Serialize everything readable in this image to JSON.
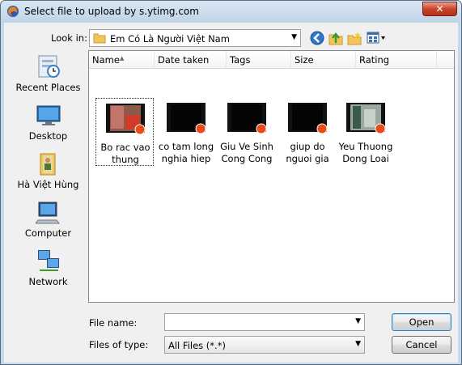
{
  "window": {
    "title": "Select file to upload by s.ytimg.com",
    "close_label": "✕"
  },
  "toolbar": {
    "lookin_label": "Look in:",
    "lookin_value": "Em Có Là Người Việt Nam",
    "icons": [
      "back-icon",
      "up-folder-icon",
      "new-folder-icon",
      "views-icon"
    ]
  },
  "places": [
    {
      "label": "Recent Places",
      "icon": "recent-places-icon"
    },
    {
      "label": "Desktop",
      "icon": "desktop-icon"
    },
    {
      "label": "Hà Việt Hùng",
      "icon": "user-folder-icon"
    },
    {
      "label": "Computer",
      "icon": "computer-icon"
    },
    {
      "label": "Network",
      "icon": "network-icon"
    }
  ],
  "columns": [
    "Name",
    "Date taken",
    "Tags",
    "Size",
    "Rating"
  ],
  "files": [
    {
      "line1": "Bo rac vao",
      "line2": "thung",
      "selected": true
    },
    {
      "line1": "co tam long",
      "line2": "nghia hiep",
      "selected": false
    },
    {
      "line1": "Giu Ve Sinh",
      "line2": "Cong Cong",
      "selected": false
    },
    {
      "line1": "giup do",
      "line2": "nguoi gia",
      "selected": false
    },
    {
      "line1": "Yeu Thuong",
      "line2": "Dong Loai",
      "selected": false
    }
  ],
  "bottom": {
    "file_name_label": "File name:",
    "file_name_value": "",
    "files_of_type_label": "Files of type:",
    "files_of_type_value": "All Files (*.*)",
    "open_label": "Open",
    "cancel_label": "Cancel"
  },
  "colors": {
    "titlebar": "#c6d9ea",
    "close": "#c7432a",
    "selection_border": "#333333"
  }
}
